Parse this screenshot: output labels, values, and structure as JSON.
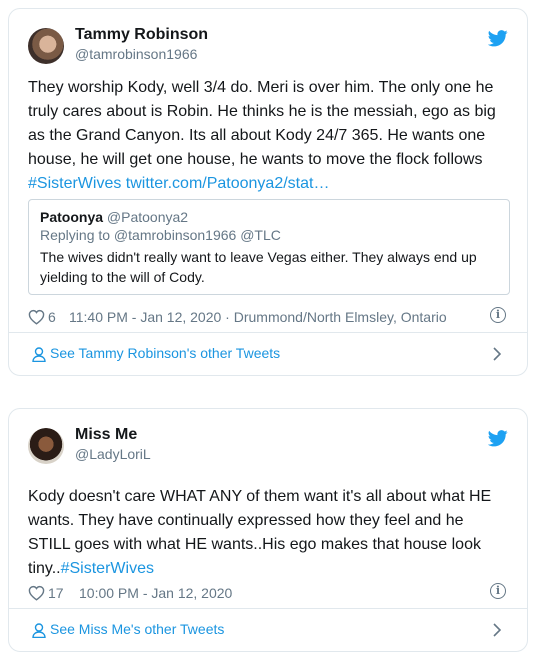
{
  "tweets": [
    {
      "author_name": "Tammy Robinson",
      "author_handle": "@tamrobinson1966",
      "text_main": "They worship Kody, well 3/4 do. Meri is over him. The only one he truly cares about is Robin. He thinks he is the messiah, ego as big as the Grand Canyon. Its all about Kody 24/7 365. He wants one house, he will get one house, he wants to move the flock follows ",
      "hashtag": "#SisterWives",
      "link": " twitter.com/Patoonya2/stat…",
      "quote": {
        "author_name": "Patoonya",
        "author_handle": "@Patoonya2",
        "replying": "Replying to @tamrobinson1966 @TLC",
        "text": "The wives didn't really want to leave Vegas either. They always end up yielding to the will of Cody."
      },
      "likes": "6",
      "timestamp": "11:40 PM - Jan 12, 2020 · Drummond/North Elmsley, Ontario",
      "footer_link": "See Tammy Robinson's other Tweets"
    },
    {
      "author_name": "Miss Me",
      "author_handle": "@LadyLoriL",
      "text_main": "Kody doesn't care WHAT ANY of them want it's all about what HE wants. They have continually expressed how they feel and he STILL goes with what HE wants..His ego makes that house look tiny..",
      "hashtag": "#SisterWives",
      "likes": "17",
      "timestamp": "10:00 PM - Jan 12, 2020",
      "footer_link": "See Miss Me's other Tweets"
    }
  ],
  "colors": {
    "accent": "#1b95e0",
    "twitter_blue": "#1da1f2",
    "muted": "#657786",
    "border": "#e1e8ed"
  },
  "icons": [
    "twitter-bird-icon",
    "heart-icon",
    "info-icon",
    "person-icon",
    "chevron-right-icon"
  ]
}
